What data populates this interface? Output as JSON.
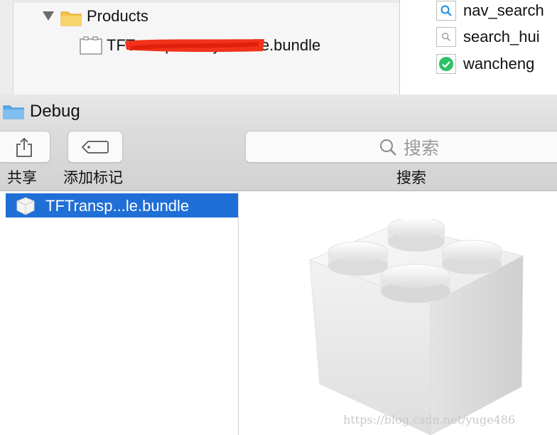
{
  "xcode": {
    "project_navigator": {
      "group_label": "Products",
      "product_file": "TFTransparencyBundle.bundle"
    },
    "assets": [
      {
        "label": "nav_search",
        "icon": "search-icon"
      },
      {
        "label": "search_hui",
        "icon": "search-icon"
      },
      {
        "label": "wancheng",
        "icon": "checkmark-icon"
      }
    ]
  },
  "finder": {
    "window_title": "Debug",
    "toolbar": {
      "share_label": "共享",
      "tag_label": "添加标记",
      "search_placeholder": "搜索",
      "search_label": "搜索"
    },
    "files": [
      {
        "name": "TFTransp...le.bundle",
        "selected": true
      }
    ],
    "watermark": "https://blog.csdn.net/yuge486"
  },
  "colors": {
    "selection": "#1f6fd6",
    "folder": "#f5c242",
    "redaction": "#f2321b",
    "check": "#2ec167"
  }
}
